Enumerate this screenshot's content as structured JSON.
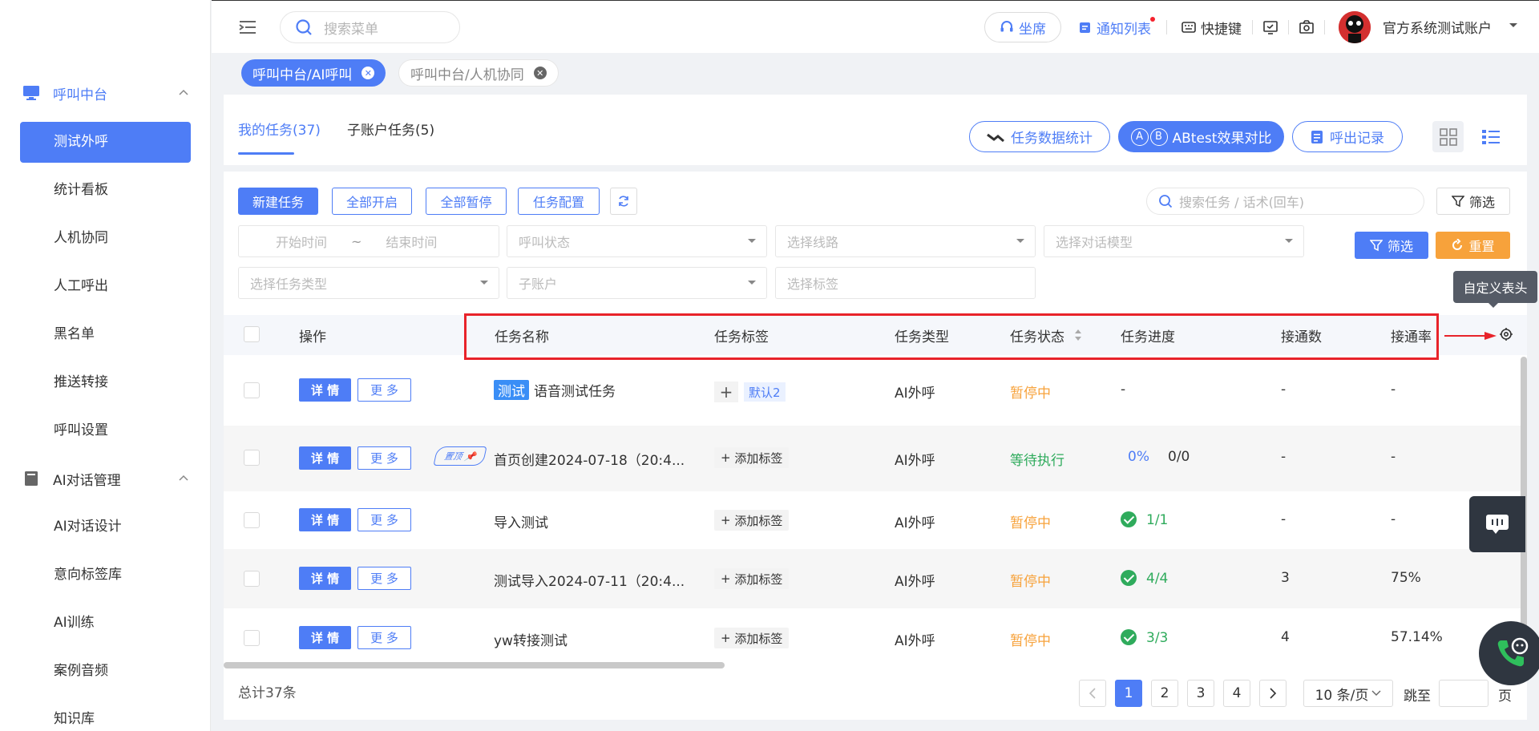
{
  "sidebar": {
    "groups": [
      {
        "label": "呼叫中台",
        "icon": "monitor-icon"
      },
      {
        "label": "AI对话管理",
        "icon": "book-icon"
      }
    ],
    "items": [
      {
        "label": "测试外呼",
        "active": true
      },
      {
        "label": "统计看板"
      },
      {
        "label": "人机协同"
      },
      {
        "label": "人工呼出"
      },
      {
        "label": "黑名单"
      },
      {
        "label": "推送转接"
      },
      {
        "label": "呼叫设置"
      },
      {
        "label": "AI对话设计"
      },
      {
        "label": "意向标签库"
      },
      {
        "label": "AI训练"
      },
      {
        "label": "案例音频"
      },
      {
        "label": "知识库"
      }
    ]
  },
  "header": {
    "search_placeholder": "搜索菜单",
    "seat": "坐席",
    "notice": "通知列表",
    "shortcut": "快捷键",
    "user": "官方系统测试账户"
  },
  "open_tabs": [
    {
      "label": "呼叫中台/AI呼叫",
      "active": true
    },
    {
      "label": "呼叫中台/人机协同",
      "active": false
    }
  ],
  "task_tabs": [
    {
      "label": "我的任务(37)",
      "active": true
    },
    {
      "label": "子账户任务(5)",
      "active": false
    }
  ],
  "top_buttons": {
    "stats": "任务数据统计",
    "abtest_a": "A",
    "abtest_b": "B",
    "abtest": "ABtest效果对比",
    "call_log": "呼出记录"
  },
  "toolbar": {
    "new_task": "新建任务",
    "start_all": "全部开启",
    "pause_all": "全部暂停",
    "config": "任务配置",
    "search_placeholder": "搜索任务 / 话术(回车)",
    "filter": "筛选"
  },
  "filters": {
    "start_time": "开始时间",
    "tilde": "~",
    "end_time": "结束时间",
    "call_status": "呼叫状态",
    "line": "选择线路",
    "model": "选择对话模型",
    "task_type": "选择任务类型",
    "sub_account": "子账户",
    "label": "选择标签",
    "filter_btn": "筛选",
    "reset_btn": "重置"
  },
  "tooltip": "自定义表头",
  "table": {
    "headers": {
      "op": "操作",
      "name": "任务名称",
      "tags": "任务标签",
      "type": "任务类型",
      "status": "任务状态",
      "progress": "任务进度",
      "connected": "接通数",
      "rate": "接通率"
    },
    "detail_label": "详 情",
    "more_label": "更 多",
    "add_tag": "添加标签",
    "test_badge": "测试",
    "pin_tag": "置顶",
    "rows": [
      {
        "name": "语音测试任务",
        "tag": "默认2",
        "type": "AI外呼",
        "status": "暂停中",
        "progress": "-",
        "connected": "-",
        "rate": "-"
      },
      {
        "name": "首页创建2024-07-18（20:4...",
        "type": "AI外呼",
        "status": "等待执行",
        "progress_pct": "0%",
        "progress": "0/0",
        "connected": "-",
        "rate": "-"
      },
      {
        "name": "导入测试",
        "type": "AI外呼",
        "status": "暂停中",
        "progress": "1/1",
        "connected": "-",
        "rate": "-"
      },
      {
        "name": "测试导入2024-07-11（20:4...",
        "type": "AI外呼",
        "status": "暂停中",
        "progress": "4/4",
        "connected": "3",
        "rate": "75%"
      },
      {
        "name": "yw转接测试",
        "type": "AI外呼",
        "status": "暂停中",
        "progress": "3/3",
        "connected": "4",
        "rate": "57.14%"
      }
    ]
  },
  "pagination": {
    "total": "总计37条",
    "pages": [
      "1",
      "2",
      "3",
      "4"
    ],
    "page_size": "10 条/页",
    "jump": "跳至",
    "unit": "页"
  },
  "colors": {
    "accent": "#4e7df6",
    "warning": "#f7a23b",
    "success": "#2fab5c",
    "highlight": "#e8232a"
  }
}
